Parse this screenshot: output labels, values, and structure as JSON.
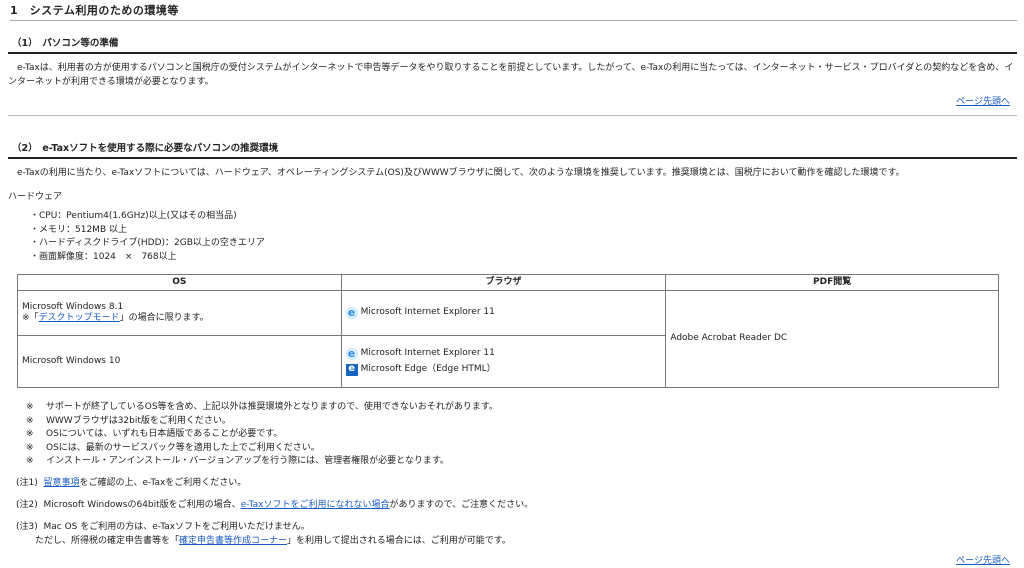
{
  "section1": {
    "title": "1　システム利用のための環境等"
  },
  "section1_1": {
    "title": "（1）　パソコン等の準備",
    "body": "e-Taxは、利用者の方が使用するパソコンと国税庁の受付システムがインターネットで申告等データをやり取りすることを前提としています。したがって、e-Taxの利用に当たっては、インターネット・サービス・プロバイダとの契約などを含め、インターネットが利用できる環境が必要となります。",
    "page_top": "ページ先頭へ"
  },
  "section1_2": {
    "title": "（2）　e-Taxソフトを使用する際に必要なパソコンの推奨環境",
    "body": "e-Taxの利用に当たり、e-Taxソフトについては、ハードウェア、オペレーティングシステム(OS)及びWWWブラウザに関して、次のような環境を推奨しています。推奨環境とは、国税庁において動作を確認した環境です。",
    "hardware_label": "ハードウェア",
    "hardware_items": [
      "・CPU：Pentium4(1.6GHz)以上(又はその相当品)",
      "・メモリ：512MB 以上",
      "・ハードディスクドライブ(HDD)：2GB以上の空きエリア",
      "・画面解像度：1024　×　768以上"
    ],
    "table": {
      "headers": [
        "OS",
        "ブラウザ",
        "PDF閲覧"
      ],
      "row1": {
        "os": "Microsoft Windows 8.1",
        "os_note_prefix": "※「",
        "os_note_link": "デスクトップモード",
        "os_note_suffix": "」の場合に限ります。",
        "browser": "Microsoft Internet Explorer 11"
      },
      "row2": {
        "os": "Microsoft Windows 10",
        "browser1": "Microsoft Internet Explorer 11",
        "browser2": "Microsoft Edge（Edge HTML）"
      },
      "pdf": "Adobe Acrobat Reader DC"
    },
    "note_mark": "※",
    "notes": [
      "サポートが終了しているOS等を含め、上記以外は推奨環境外となりますので、使用できないおそれがあります。",
      "WWWブラウザは32bit版をご利用ください。",
      "OSについては、いずれも日本語版であることが必要です。",
      "OSには、最新のサービスパック等を適用した上でご利用ください。",
      "インストール・アンインストール・バージョンアップを行う際には、管理者権限が必要となります。"
    ],
    "fn1": {
      "label": "(注1)",
      "link": "留意事項",
      "text": "をご確認の上、e-Taxをご利用ください。"
    },
    "fn2": {
      "label": "(注2)",
      "text_before": "Microsoft Windowsの64bit版をご利用の場合、",
      "link": "e-Taxソフトをご利用になれない場合",
      "text_after": "がありますので、ご注意ください。"
    },
    "fn3": {
      "label": "(注3)",
      "line1": "Mac OS をご利用の方は、e-Taxソフトをご利用いただけません。",
      "line2_before": "ただし、所得税の確定申告書等を「",
      "link": "確定申告書等作成コーナー",
      "line2_after": "」を利用して提出される場合には、ご利用が可能です。"
    },
    "page_top": "ページ先頭へ"
  },
  "icons": {
    "ie": "internet-explorer-icon",
    "edge": "edge-legacy-icon"
  }
}
